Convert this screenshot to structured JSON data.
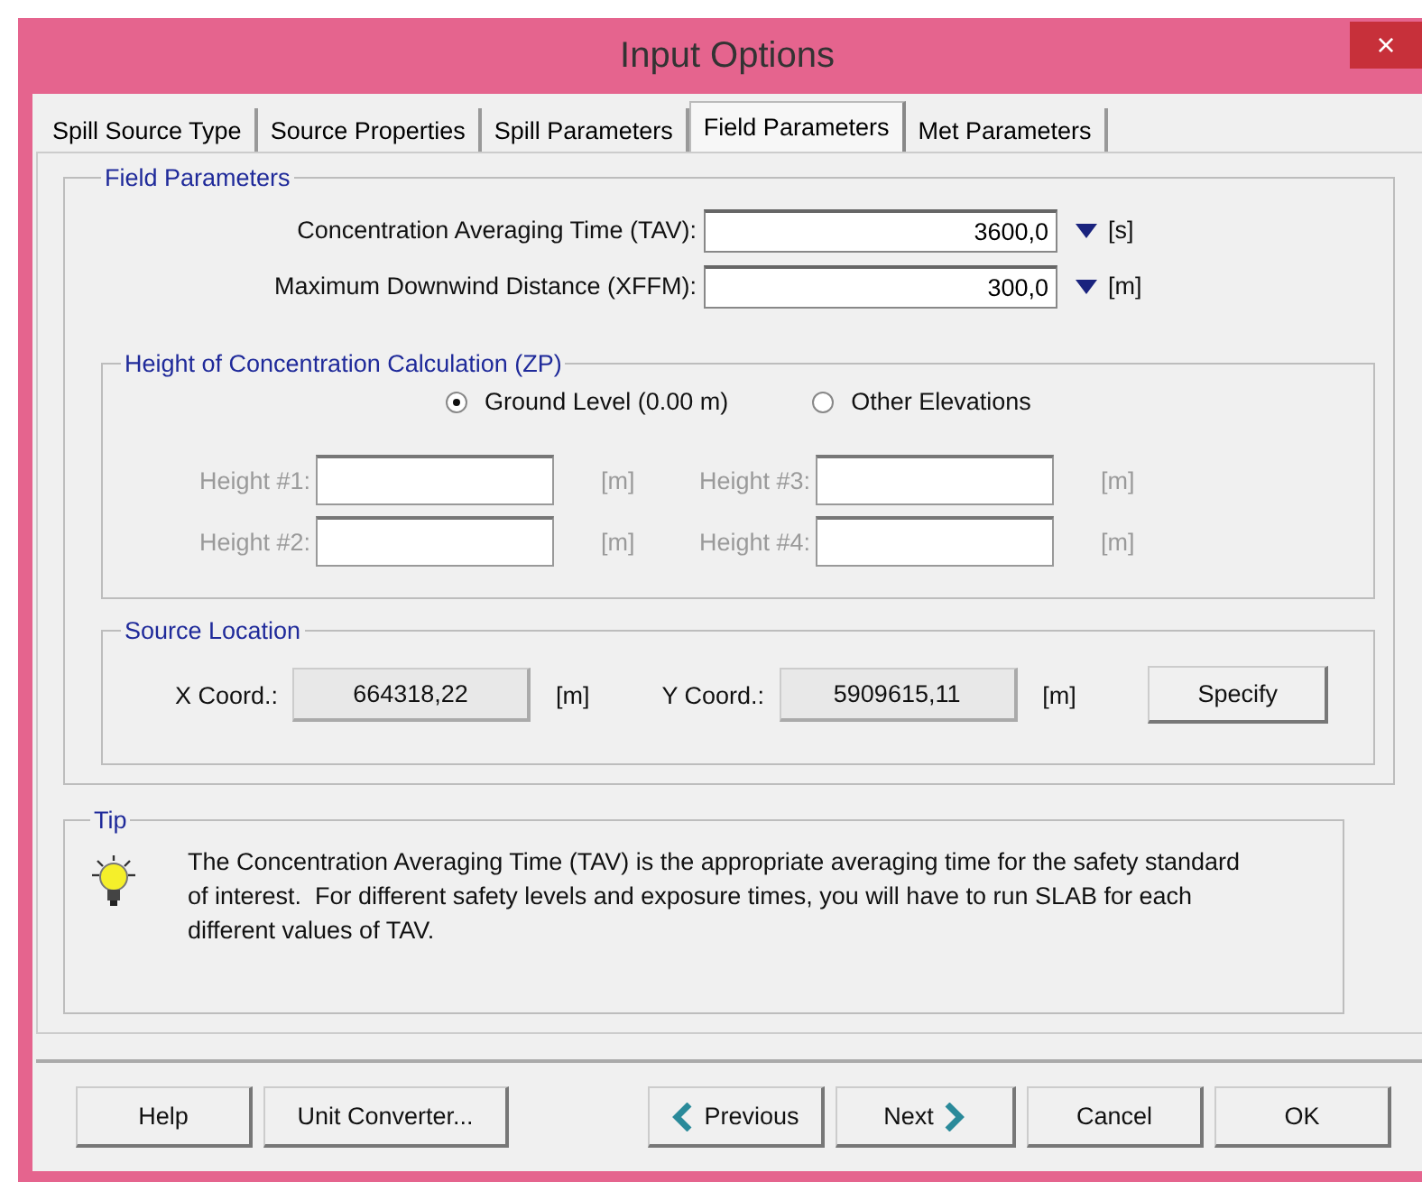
{
  "window": {
    "title": "Input Options",
    "close": "×"
  },
  "tabs": [
    {
      "label": "Spill Source Type",
      "selected": false
    },
    {
      "label": "Source Properties",
      "selected": false
    },
    {
      "label": "Spill Parameters",
      "selected": false
    },
    {
      "label": "Field Parameters",
      "selected": true
    },
    {
      "label": "Met Parameters",
      "selected": false
    }
  ],
  "field_parameters": {
    "title": "Field Parameters",
    "fields": [
      {
        "label": "Concentration Averaging Time (TAV):",
        "value": "3600,0",
        "unit": "[s]"
      },
      {
        "label": "Maximum Downwind Distance (XFFM):",
        "value": "300,0",
        "unit": "[m]"
      }
    ]
  },
  "height_group": {
    "title": "Height of Concentration Calculation (ZP)",
    "options": [
      {
        "label": "Ground Level (0.00 m)",
        "selected": true
      },
      {
        "label": "Other Elevations",
        "selected": false
      }
    ],
    "heights": [
      {
        "label": "Height #1:",
        "unit": "[m]",
        "disabled": true
      },
      {
        "label": "Height #3:",
        "unit": "[m]",
        "disabled": true
      },
      {
        "label": "Height #2:",
        "unit": "[m]",
        "disabled": true
      },
      {
        "label": "Height #4:",
        "unit": "[m]",
        "disabled": true
      }
    ]
  },
  "source_location": {
    "title": "Source Location",
    "coords": [
      {
        "label": "X Coord.:",
        "value": "664318,22",
        "unit": "[m]"
      },
      {
        "label": "Y Coord.:",
        "value": "5909615,11",
        "unit": "[m]"
      }
    ],
    "button": "Specify"
  },
  "tip": {
    "title": "Tip",
    "text": "The Concentration Averaging Time (TAV) is the appropriate averaging time for the safety standard of interest.  For different safety levels and exposure times, you will have to run SLAB for each different values of TAV."
  },
  "buttons": [
    {
      "label": "Help",
      "kind": "plain"
    },
    {
      "label": "Unit Converter...",
      "kind": "plain"
    },
    {
      "label": "Previous",
      "kind": "previous"
    },
    {
      "label": "Next",
      "kind": "next"
    },
    {
      "label": "Cancel",
      "kind": "plain"
    },
    {
      "label": "OK",
      "kind": "plain"
    }
  ]
}
